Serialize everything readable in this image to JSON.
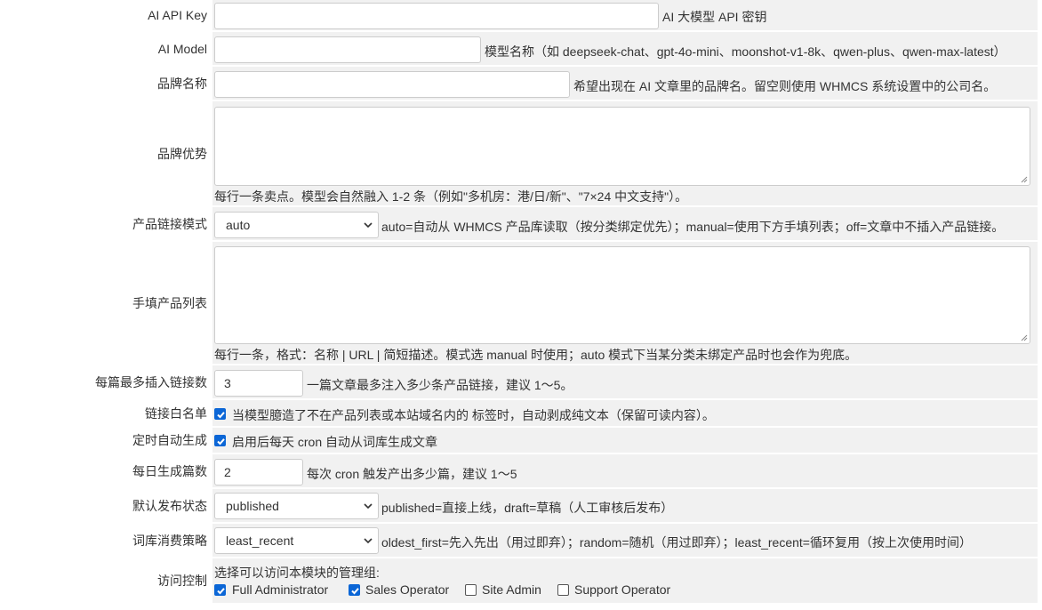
{
  "fields": {
    "api_key": {
      "label": "AI API Key",
      "value": "",
      "help": "AI 大模型 API 密钥"
    },
    "model": {
      "label": "AI Model",
      "value": "",
      "help": "模型名称（如 deepseek-chat、gpt-4o-mini、moonshot-v1-8k、qwen-plus、qwen-max-latest）"
    },
    "brand_name": {
      "label": "品牌名称",
      "value": "",
      "help": "希望出现在 AI 文章里的品牌名。留空则使用 WHMCS 系统设置中的公司名。"
    },
    "brand_advantages": {
      "label": "品牌优势",
      "value": "",
      "help": "每行一条卖点。模型会自然融入 1-2 条（例如\"多机房：港/日/新\"、\"7×24 中文支持\"）。"
    },
    "link_mode": {
      "label": "产品链接模式",
      "selected": "auto",
      "help": "auto=自动从 WHMCS 产品库读取（按分类绑定优先）；manual=使用下方手填列表；off=文章中不插入产品链接。"
    },
    "manual_products": {
      "label": "手填产品列表",
      "value": "",
      "help": "每行一条，格式：名称 | URL | 简短描述。模式选 manual 时使用；auto 模式下当某分类未绑定产品时也会作为兜底。"
    },
    "max_links": {
      "label": "每篇最多插入链接数",
      "value": "3",
      "help": "一篇文章最多注入多少条产品链接，建议 1～5。"
    },
    "link_whitelist": {
      "label": "链接白名单",
      "checked": true,
      "help": "当模型臆造了不在产品列表或本站域名内的 标签时，自动剥成纯文本（保留可读内容）。"
    },
    "auto_generate": {
      "label": "定时自动生成",
      "checked": true,
      "help": "启用后每天 cron 自动从词库生成文章"
    },
    "daily_count": {
      "label": "每日生成篇数",
      "value": "2",
      "help": "每次 cron 触发产出多少篇，建议 1～5"
    },
    "publish_status": {
      "label": "默认发布状态",
      "selected": "published",
      "help": "published=直接上线，draft=草稿（人工审核后发布）"
    },
    "keyword_strategy": {
      "label": "词库消费策略",
      "selected": "least_recent",
      "help": "oldest_first=先入先出（用过即弃）；random=随机（用过即弃）；least_recent=循环复用（按上次使用时间）"
    },
    "access_control": {
      "label": "访问控制",
      "help": "选择可以访问本模块的管理组:",
      "groups": [
        {
          "name": "Full Administrator",
          "checked": true
        },
        {
          "name": "Sales Operator",
          "checked": true
        },
        {
          "name": "Site Admin",
          "checked": false
        },
        {
          "name": "Support Operator",
          "checked": false
        }
      ]
    }
  },
  "colors": {
    "row_bg": "#f1f1f1",
    "checkbox_accent": "#0b66d6",
    "border": "#cccccc"
  },
  "icons": {
    "select": "chevron-down-icon",
    "checkbox": "checkmark-icon",
    "textarea": "resize-grip-icon"
  }
}
